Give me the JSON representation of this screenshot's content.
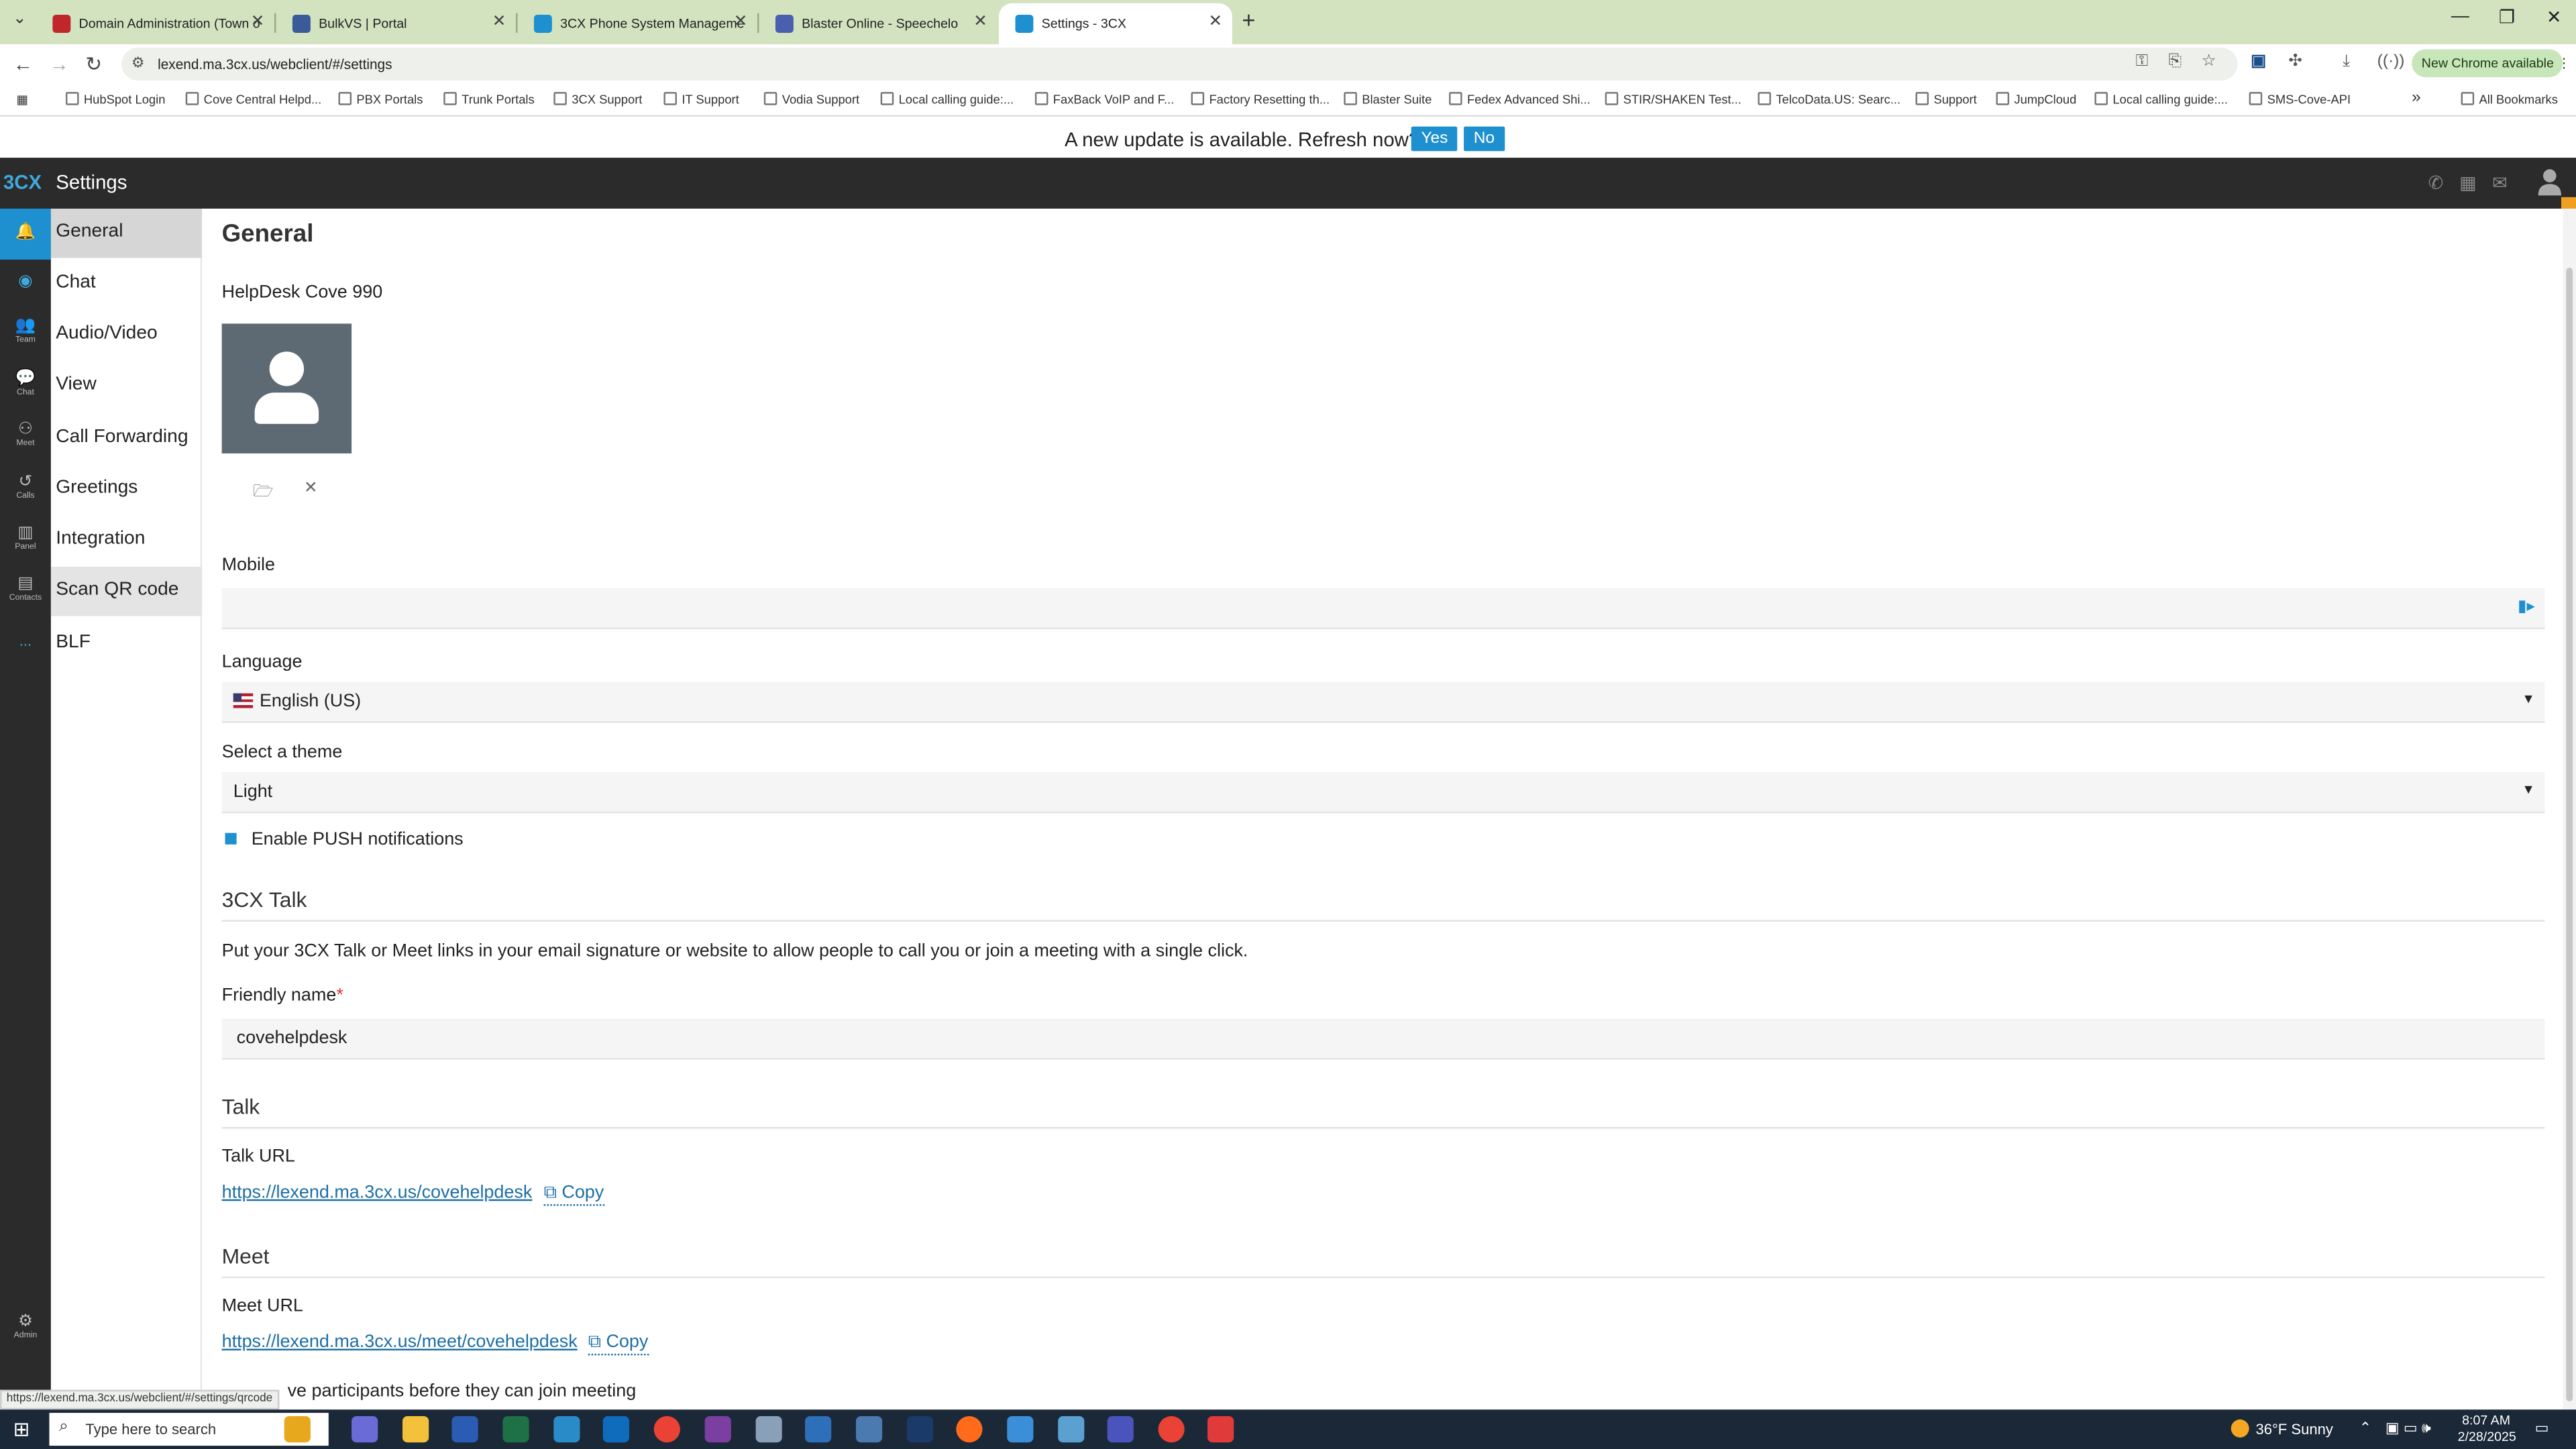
{
  "browser": {
    "tabs": [
      {
        "title": "Domain Administration (Town o",
        "icon_color": "#c0272d"
      },
      {
        "title": "BulkVS | Portal",
        "icon_color": "#3a5a9a"
      },
      {
        "title": "3CX Phone System Manageme",
        "icon_color": "#1e90d0"
      },
      {
        "title": "Blaster Online - Speechelo",
        "icon_color": "#4a5fb0"
      },
      {
        "title": "Settings - 3CX",
        "icon_color": "#1e90d0"
      }
    ],
    "url": "lexend.ma.3cx.us/webclient/#/settings",
    "new_chrome_label": "New Chrome available",
    "bookmarks": [
      "HubSpot Login",
      "Cove Central Helpd...",
      "PBX Portals",
      "Trunk Portals",
      "3CX Support",
      "IT Support",
      "Vodia Support",
      "Local calling guide:...",
      "FaxBack VoIP and F...",
      "Factory Resetting th...",
      "Blaster Suite",
      "Fedex Advanced Shi...",
      "STIR/SHAKEN Test...",
      "TelcoData.US: Searc...",
      "Support",
      "JumpCloud",
      "Local calling guide:...",
      "SMS-Cove-API"
    ],
    "all_bookmarks_label": "All Bookmarks",
    "status_url": "https://lexend.ma.3cx.us/webclient/#/settings/qrcode"
  },
  "update_banner": {
    "message": "A new update is available. Refresh now?",
    "yes_label": "Yes",
    "no_label": "No"
  },
  "app": {
    "logo": "3CX",
    "title": "Settings"
  },
  "rail": {
    "items": [
      "",
      "",
      "Team",
      "Chat",
      "Meet",
      "Calls",
      "Panel",
      "Contacts",
      "...",
      "Admin"
    ]
  },
  "settings_menu": [
    "General",
    "Chat",
    "Audio/Video",
    "View",
    "Call Forwarding",
    "Greetings",
    "Integration",
    "Scan QR code",
    "BLF"
  ],
  "general": {
    "heading": "General",
    "user_name": "HelpDesk Cove 990",
    "mobile_label": "Mobile",
    "mobile_value": "",
    "language_label": "Language",
    "language_value": "English (US)",
    "theme_label": "Select a theme",
    "theme_value": "Light",
    "push_label": "Enable PUSH notifications",
    "push_enabled": true
  },
  "talk3cx": {
    "heading": "3CX Talk",
    "description": "Put your 3CX Talk or Meet links in your email signature or website to allow people to call you or join a meeting with a single click.",
    "friendly_name_label": "Friendly name",
    "required_mark": "*",
    "friendly_name_value": "covehelpdesk",
    "talk_heading": "Talk",
    "talk_url_label": "Talk URL",
    "talk_url": "https://lexend.ma.3cx.us/covehelpdesk",
    "copy_label": "Copy",
    "meet_heading": "Meet",
    "meet_url_label": "Meet URL",
    "meet_url": "https://lexend.ma.3cx.us/meet/covehelpdesk",
    "approve_text": "ve participants before they can join meeting"
  },
  "taskbar": {
    "search_placeholder": "Type here to search",
    "weather": "36°F  Sunny",
    "time": "8:07 AM",
    "date": "2/28/2025"
  },
  "colors": {
    "accent": "#1e90d0",
    "header_bg": "#2b2b2b",
    "tabstrip_bg": "#d3e3c0"
  }
}
